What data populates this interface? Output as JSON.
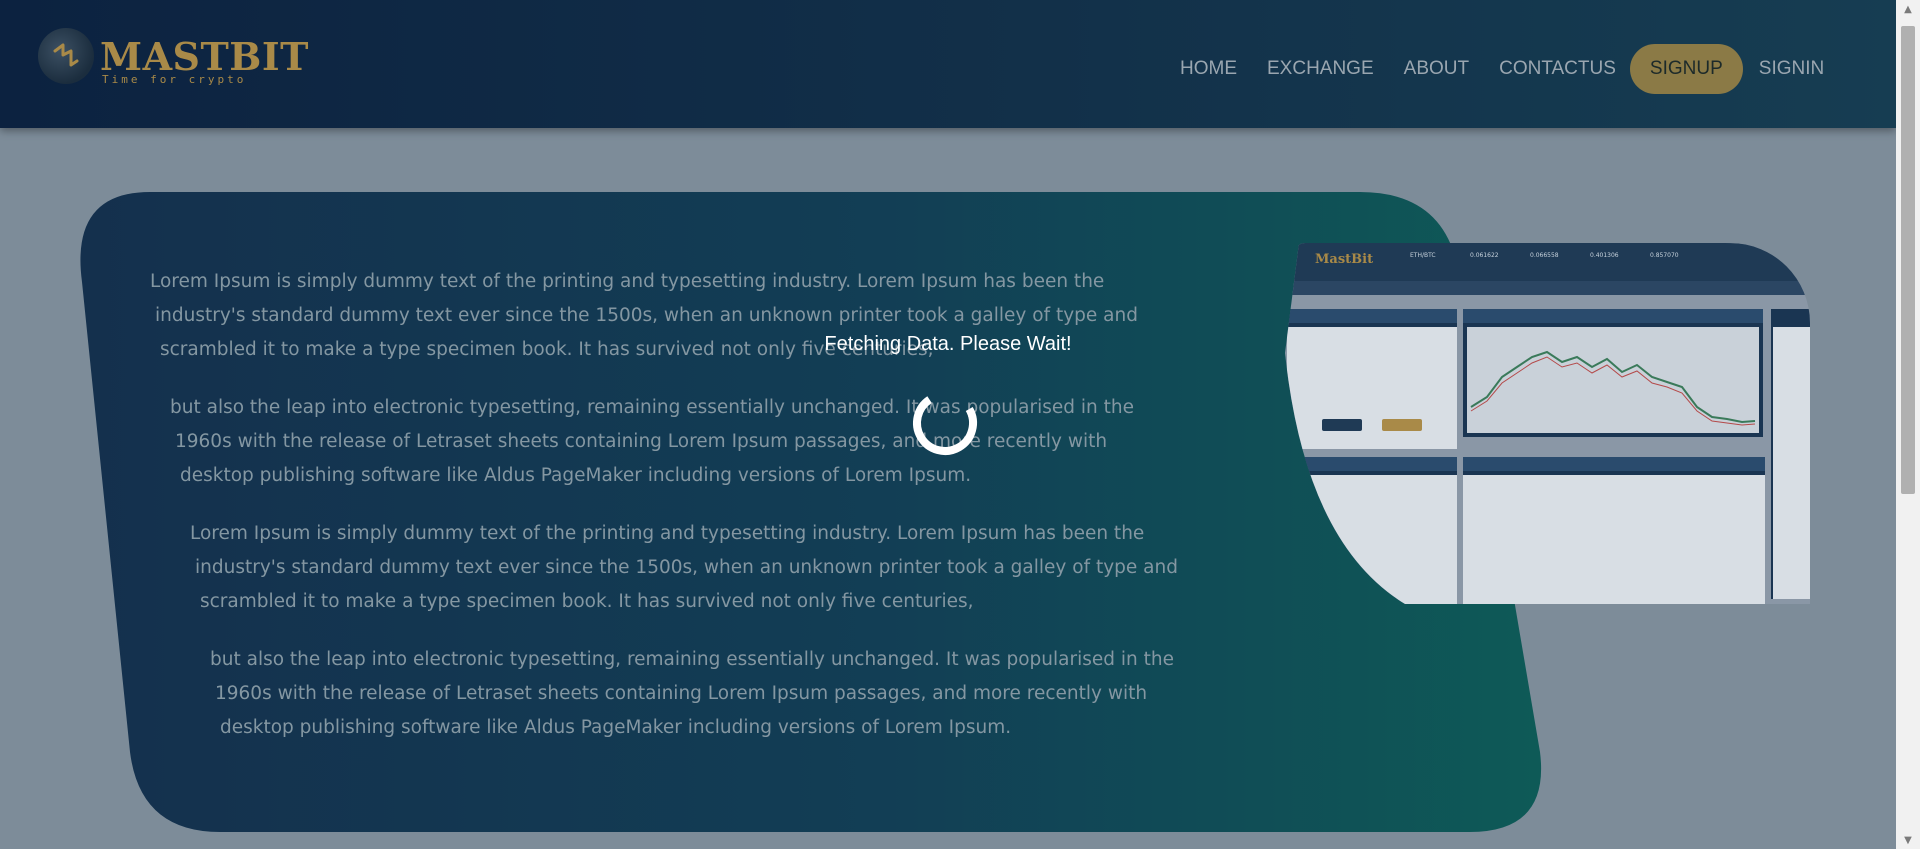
{
  "brand": {
    "name": "MastBit",
    "name_display": "MASTBIT",
    "tagline": "Time for crypto",
    "color": "#a98a48"
  },
  "nav": {
    "items": [
      {
        "label": "HOME"
      },
      {
        "label": "EXCHANGE"
      },
      {
        "label": "ABOUT"
      },
      {
        "label": "CONTACTUS"
      }
    ],
    "signup_label": "SIGNUP",
    "signin_label": "SIGNIN"
  },
  "hero": {
    "paragraphs": [
      [
        "Lorem Ipsum is simply dummy text of the printing and typesetting industry. Lorem Ipsum has been the",
        "industry's standard dummy text ever since the 1500s, when an unknown printer took a galley of type and",
        "scrambled it to make a type specimen book. It has survived not only five centuries,"
      ],
      [
        "but also the leap into electronic typesetting, remaining essentially unchanged. It was popularised in the",
        "1960s with the release of Letraset sheets containing Lorem Ipsum passages, and more recently with",
        "desktop publishing software like Aldus PageMaker including versions of Lorem Ipsum."
      ],
      [
        "Lorem Ipsum is simply dummy text of the printing and typesetting industry. Lorem Ipsum has been the",
        "industry's standard dummy text ever since the 1500s, when an unknown printer took a galley of type and",
        "scrambled it to make a type specimen book. It has survived not only five centuries,"
      ],
      [
        "but also the leap into electronic typesetting, remaining essentially unchanged. It was popularised in the",
        "1960s with the release of Letraset sheets containing Lorem Ipsum passages, and more recently with",
        "desktop publishing software like Aldus PageMaker including versions of Lorem Ipsum."
      ]
    ],
    "preview": {
      "logo": "MastBit",
      "stats": [
        "ETH/BTC",
        "0.061622",
        "0.066558",
        "0.401306",
        "0.857070"
      ]
    }
  },
  "loading": {
    "message": "Fetching Data. Please Wait!"
  },
  "colors": {
    "header_bg": "#0c2240",
    "hero_gradient_start": "#0f2d4d",
    "hero_gradient_end": "#0d5452",
    "accent": "#a98a48"
  },
  "icons": {
    "logo": "mastbit-logo-icon",
    "spinner": "loading-spinner-icon"
  }
}
